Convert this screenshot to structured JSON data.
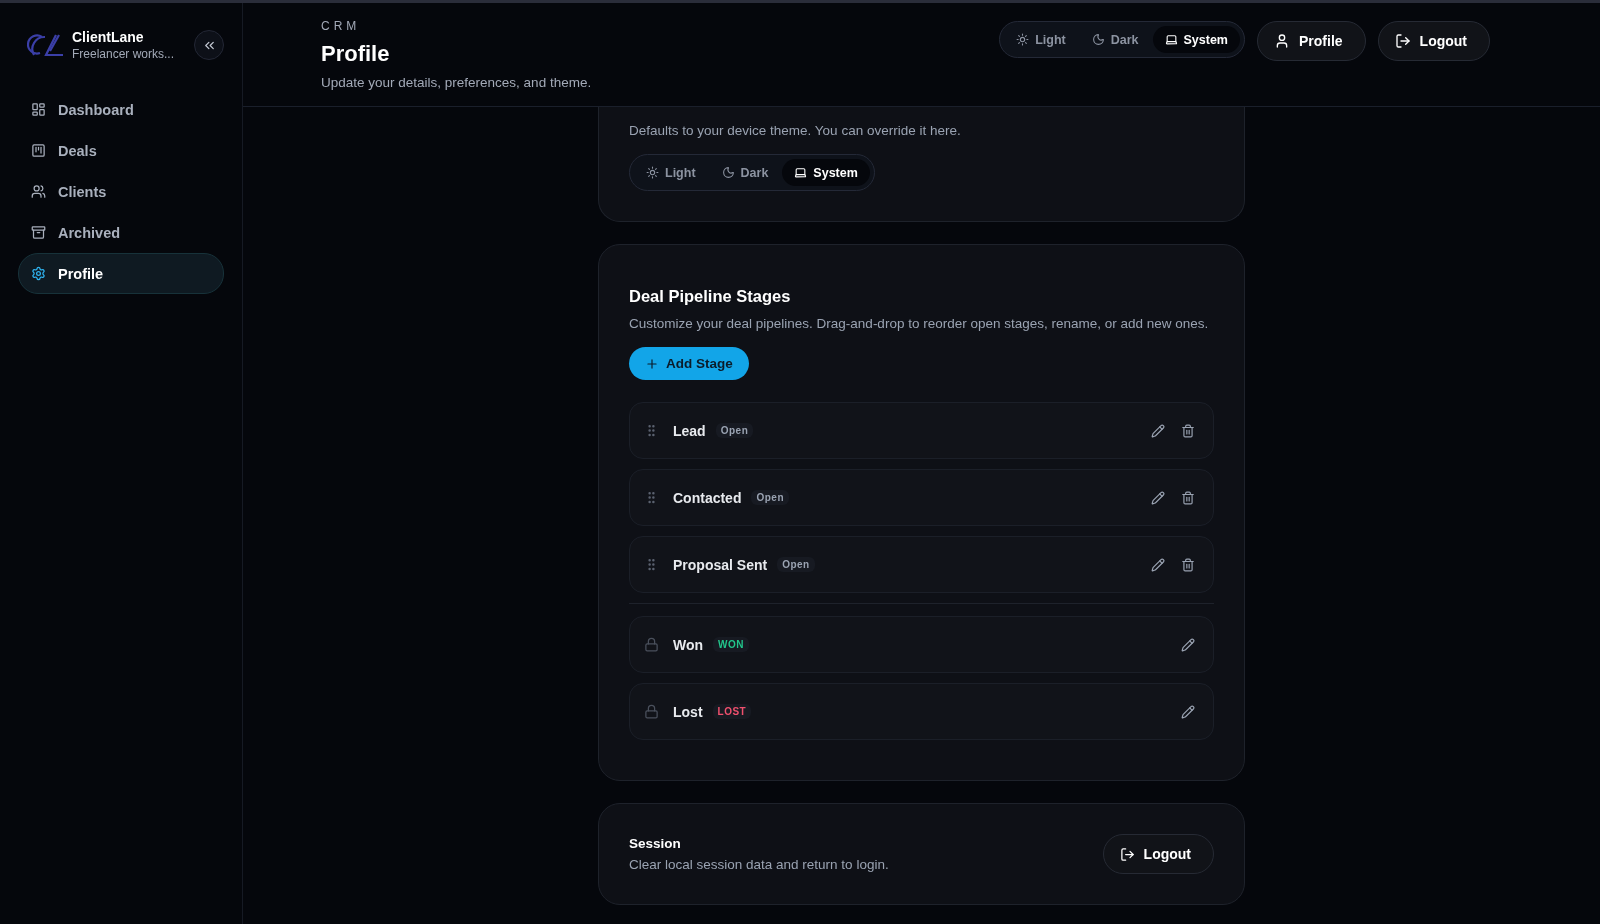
{
  "sidebar": {
    "brand": {
      "name": "ClientLane",
      "subtitle": "Freelancer works..."
    },
    "items": [
      {
        "label": "Dashboard",
        "selected": false
      },
      {
        "label": "Deals",
        "selected": false
      },
      {
        "label": "Clients",
        "selected": false
      },
      {
        "label": "Archived",
        "selected": false
      },
      {
        "label": "Profile",
        "selected": true
      }
    ]
  },
  "header": {
    "eyebrow": "CRM",
    "title": "Profile",
    "subtitle": "Update your details, preferences, and theme.",
    "theme_toggle": [
      {
        "label": "Light",
        "selected": false
      },
      {
        "label": "Dark",
        "selected": false
      },
      {
        "label": "System",
        "selected": true
      }
    ],
    "profile_button": "Profile",
    "logout_button": "Logout"
  },
  "appearance": {
    "description": "Defaults to your device theme. You can override it here.",
    "theme_toggle": [
      {
        "label": "Light",
        "selected": false
      },
      {
        "label": "Dark",
        "selected": false
      },
      {
        "label": "System",
        "selected": true
      }
    ]
  },
  "pipeline": {
    "title": "Deal Pipeline Stages",
    "description": "Customize your deal pipelines. Drag-and-drop to reorder open stages, rename, or add new ones.",
    "add_button": "Add Stage",
    "stages": [
      {
        "name": "Lead",
        "badge": "Open",
        "kind": "open",
        "color": "#9aa3b2"
      },
      {
        "name": "Contacted",
        "badge": "Open",
        "kind": "open",
        "color": "#9aa3b2"
      },
      {
        "name": "Proposal Sent",
        "badge": "Open",
        "kind": "open",
        "color": "#9aa3b2"
      },
      {
        "name": "Won",
        "badge": "WON",
        "kind": "closed",
        "color": "#22c58b"
      },
      {
        "name": "Lost",
        "badge": "LOST",
        "kind": "closed",
        "color": "#f0506e"
      }
    ]
  },
  "session": {
    "title": "Session",
    "description": "Clear local session data and return to login.",
    "logout_button": "Logout"
  }
}
